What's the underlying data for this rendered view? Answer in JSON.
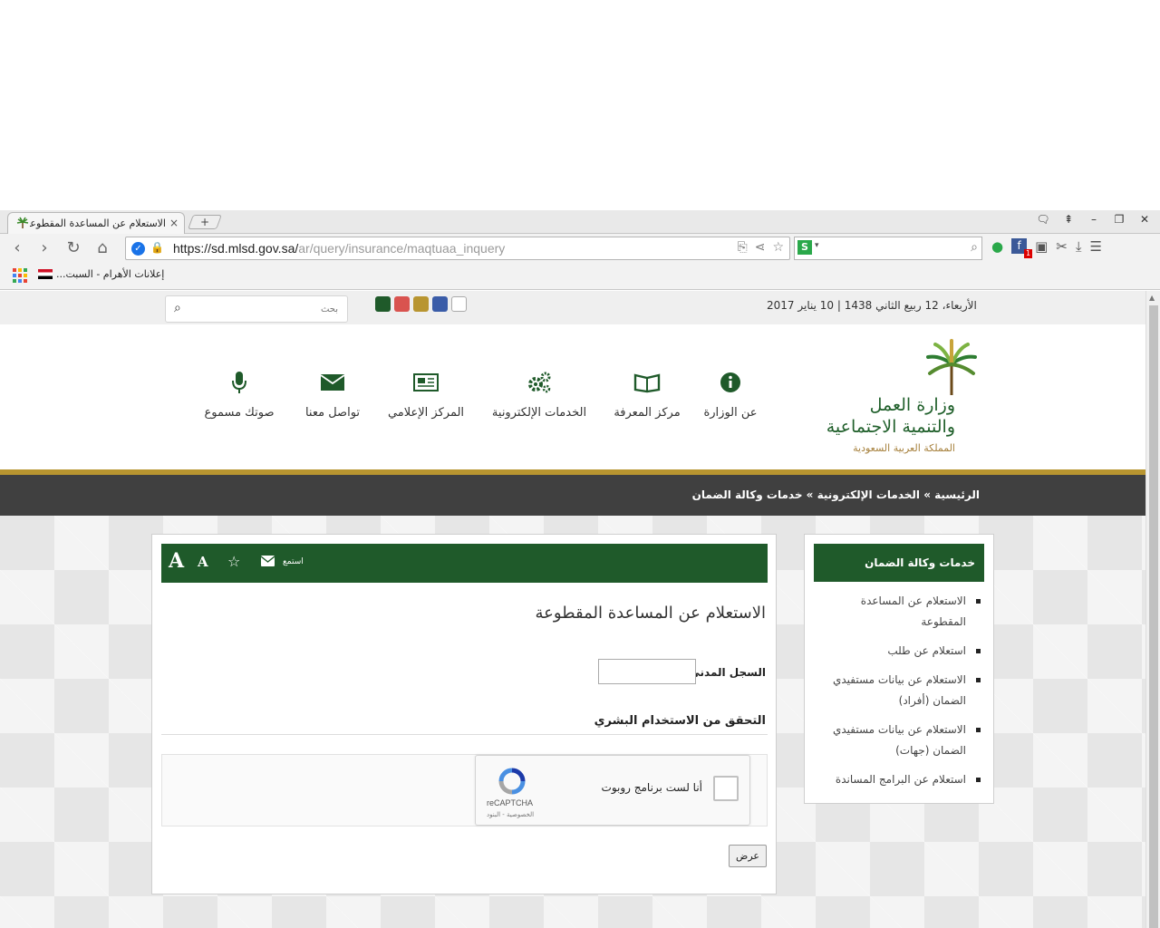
{
  "tab": {
    "title": "الاستعلام عن المساعدة المقطوعة",
    "close": "×",
    "new": "+"
  },
  "window": {
    "icons": [
      "chat-icon",
      "pin-icon",
      "minimize-icon",
      "restore-icon",
      "close-icon"
    ],
    "minimize": "–",
    "restore": "❐",
    "close": "✕",
    "chat": "🗨",
    "pin": "⇞"
  },
  "omnibox": {
    "domain": "https://sd.mlsd.gov.sa/",
    "path": "ar/query/insurance/maqtuaa_inquery"
  },
  "search_engine": {
    "badge": "S"
  },
  "bookmarks": {
    "item1": "إعلانات الأهرام - السبت..."
  },
  "site": {
    "search_placeholder": "بحث",
    "date": "الأربعاء، 12 ربيع الثاني 1438 | 10 يناير 2017",
    "swatch_colors": [
      "#1f5a2a",
      "#d9534f",
      "#b89530",
      "#3a5ca8",
      "#ffffff"
    ],
    "logo": {
      "line1": "وزارة العمل",
      "line2": "والتنمية الاجتماعية",
      "line3": "المملكة العربية السعودية"
    },
    "nav": [
      {
        "label": "عن الوزارة",
        "icon": "info-icon"
      },
      {
        "label": "مركز المعرفة",
        "icon": "book-icon"
      },
      {
        "label": "الخدمات الإلكترونية",
        "icon": "gears-icon"
      },
      {
        "label": "المركز الإعلامي",
        "icon": "newspaper-icon"
      },
      {
        "label": "تواصل معنا",
        "icon": "envelope-icon"
      },
      {
        "label": "صوتك مسموع",
        "icon": "microphone-icon"
      }
    ],
    "breadcrumb": "الرئيسية » الخدمات الإلكترونية » خدمات وكالة الضمان",
    "accent": "#1f5a2a",
    "gold": "#b89530"
  },
  "sidebar": {
    "title": "خدمات وكالة الضمان",
    "items": [
      "الاستعلام عن المساعدة المقطوعة",
      "استعلام عن طلب",
      "الاستعلام عن بيانات مستفيدي الضمان (أفراد)",
      "الاستعلام عن بيانات مستفيدي الضمان (جهات)",
      "استعلام عن البرامج المساندة"
    ]
  },
  "main": {
    "toolbar": {
      "font_big": "A",
      "font_small": "A",
      "listen": "استمع"
    },
    "title": "الاستعلام عن المساعدة المقطوعة",
    "civil_label": "السجل المدني",
    "required": "*",
    "verify_title": "التحقق من الاستخدام البشري",
    "recaptcha": {
      "label": "أنا لست برنامج روبوت",
      "brand": "reCAPTCHA",
      "links": "الخصوصية - البنود"
    },
    "submit": "عرض"
  }
}
